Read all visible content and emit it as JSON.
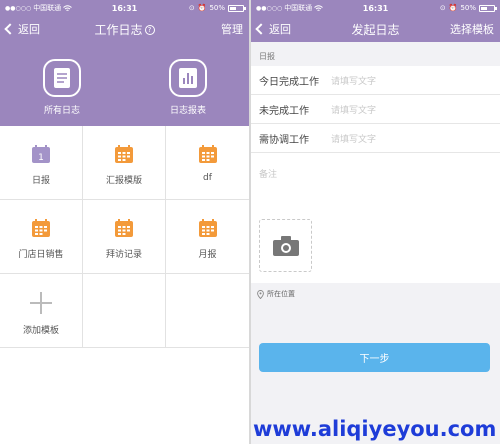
{
  "status_bar": {
    "carrier": "中国联通",
    "time": "16:31",
    "battery": "50%",
    "battery_level": 0.5
  },
  "left": {
    "back_label": "返回",
    "title": "工作日志",
    "help": "?",
    "right_action": "管理",
    "hero": [
      {
        "label": "所有日志",
        "icon": "document-icon"
      },
      {
        "label": "日志报表",
        "icon": "bar-chart-icon"
      }
    ],
    "templates": [
      {
        "label": "日报",
        "icon": "calendar-purple-icon"
      },
      {
        "label": "汇报模版",
        "icon": "calendar-orange-icon"
      },
      {
        "label": "df",
        "icon": "calendar-orange-icon"
      },
      {
        "label": "门店日销售",
        "icon": "calendar-orange-icon"
      },
      {
        "label": "拜访记录",
        "icon": "calendar-orange-icon"
      },
      {
        "label": "月报",
        "icon": "calendar-orange-icon"
      },
      {
        "label": "添加模板",
        "icon": "plus-icon"
      }
    ],
    "calendar_day": "1"
  },
  "right": {
    "back_label": "返回",
    "title": "发起日志",
    "right_action": "选择模板",
    "section": "日报",
    "fields": [
      {
        "label": "今日完成工作",
        "placeholder": "请填写文字"
      },
      {
        "label": "未完成工作",
        "placeholder": "请填写文字"
      },
      {
        "label": "需协调工作",
        "placeholder": "请填写文字"
      }
    ],
    "remark_placeholder": "备注",
    "location": "所在位置",
    "next_button": "下一步"
  },
  "watermark": "www.aliqiyeyou.com",
  "colors": {
    "header": "#9b86bd",
    "button": "#5ab4ec",
    "calendar_orange": "#f39a3a",
    "calendar_purple": "#a393c8",
    "watermark": "#1e3cd8"
  }
}
